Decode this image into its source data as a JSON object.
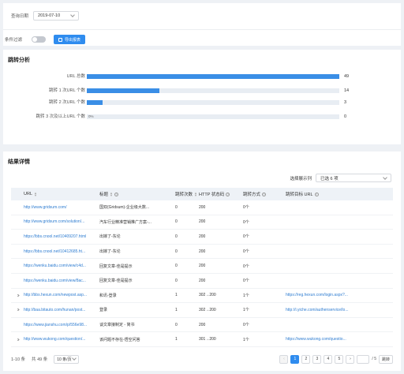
{
  "query": {
    "date_label": "查询日期",
    "date_value": "2019-07-10",
    "filter_label": "条件过滤",
    "export_label": "导出报表"
  },
  "analysis": {
    "title": "跳转分析",
    "bars": [
      {
        "label": "URL 总数",
        "value": "49",
        "fill": 1.0,
        "pct": ""
      },
      {
        "label": "跳转 1 次URL 个数",
        "value": "14",
        "fill": 0.286,
        "pct": ""
      },
      {
        "label": "跳转 2 次URL 个数",
        "value": "3",
        "fill": 0.061,
        "pct": ""
      },
      {
        "label": "跳转 3 次及以上URL 个数",
        "value": "0",
        "fill": 0.0,
        "pct": "0%"
      }
    ],
    "bar_color": "#3a8ee6"
  },
  "results": {
    "title": "结果详情",
    "col_select_label": "选择展示列",
    "col_select_value": "已选 6 项",
    "columns": [
      "URL",
      "标题",
      "跳转次数",
      "HTTP 状态码",
      "跳转方式",
      "跳转目标 URL"
    ],
    "rows": [
      {
        "expand": false,
        "url": "http://www.gridsum.com/",
        "title": "国双(Gridsum)-企业级大数...",
        "count": "0",
        "status": "200",
        "method": "0个",
        "target": ""
      },
      {
        "expand": false,
        "url": "http://www.gridsum.com/solution/...",
        "title": "汽车行业精准营销推广方案-...",
        "count": "0",
        "status": "200",
        "method": "0个",
        "target": ""
      },
      {
        "expand": false,
        "url": "https://bbs.cnool.net/10409207.html",
        "title": "出嫁了-东论",
        "count": "0",
        "status": "200",
        "method": "0个",
        "target": ""
      },
      {
        "expand": false,
        "url": "https://bbs.cnool.net/10412685.ht...",
        "title": "出嫁了-东论",
        "count": "0",
        "status": "200",
        "method": "0个",
        "target": ""
      },
      {
        "expand": false,
        "url": "https://wenku.baidu.com/view/c4d...",
        "title": "回复文章-佳是提示",
        "count": "0",
        "status": "200",
        "method": "0个",
        "target": ""
      },
      {
        "expand": false,
        "url": "https://wenku.baidu.com/view/8ac...",
        "title": "回复文章-佳是提示",
        "count": "0",
        "status": "200",
        "method": "0个",
        "target": ""
      },
      {
        "expand": true,
        "url": "http://bbs.hexun.com/newpost.asp...",
        "title": "和讯-登录",
        "count": "1",
        "status": "302→200",
        "method": "1个",
        "target": "https://reg.hexun.com/login.aspx?..."
      },
      {
        "expand": true,
        "url": "http://baa.bitauto.com/hunan/post...",
        "title": "登录",
        "count": "1",
        "status": "302→200",
        "method": "1个",
        "target": "http://i.yiche.com/authenservice/lo..."
      },
      {
        "expand": false,
        "url": "https://www.jianshu.com/p/556e98...",
        "title": "谈文章接制定 - 简书",
        "count": "0",
        "status": "200",
        "method": "0个",
        "target": ""
      },
      {
        "expand": true,
        "url": "http://www.wukong.com/question/...",
        "title": "该问题不存在-悟空问答",
        "count": "1",
        "status": "301→200",
        "method": "1个",
        "target": "https://www.wukong.com/questio..."
      }
    ]
  },
  "pager": {
    "range": "1-10 条",
    "total": "共 49 条",
    "page_size": "10 条/页",
    "pages": [
      "1",
      "2",
      "3",
      "4",
      "5"
    ],
    "active_page": "1",
    "prev": "‹",
    "next": "›",
    "jump_total": "/ 5",
    "jump_label": "跳转"
  }
}
